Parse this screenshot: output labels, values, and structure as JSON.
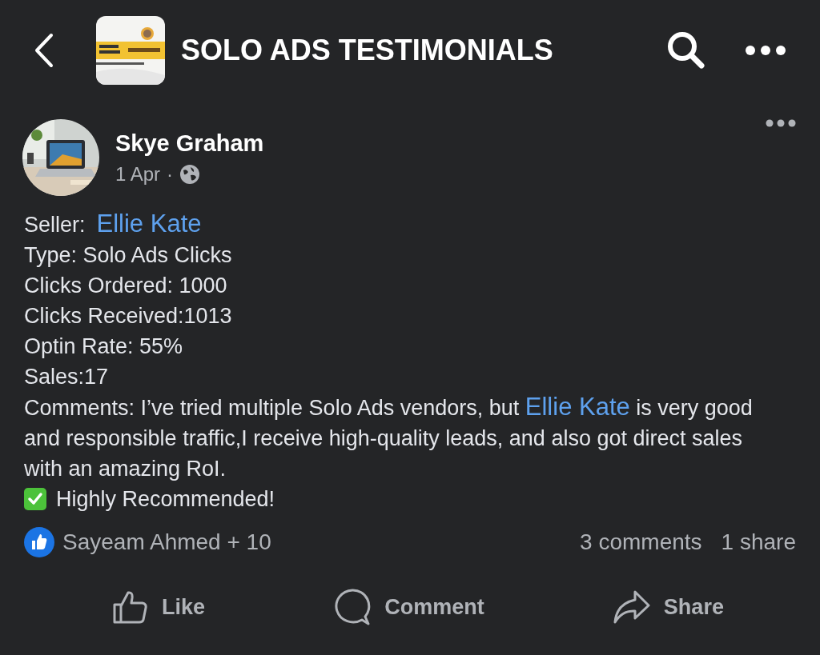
{
  "header": {
    "title": "SOLO ADS TESTIMONIALS"
  },
  "post": {
    "author": "Skye Graham",
    "time": "1 Apr",
    "separator": "·",
    "lines": [
      {
        "kind": "link",
        "text": "Seller:",
        "link": "Ellie Kate"
      },
      {
        "kind": "plain",
        "text": "Type: Solo Ads Clicks"
      },
      {
        "kind": "plain",
        "text": "Clicks Ordered: 1000"
      },
      {
        "kind": "plain",
        "text": "Clicks Received:1013"
      },
      {
        "kind": "plain",
        "text": "Optin Rate: 55%"
      },
      {
        "kind": "plain",
        "text": "Sales:17"
      }
    ],
    "comments": {
      "before": "Comments: I’ve tried multiple Solo Ads vendors, but",
      "link": "Ellie Kate",
      "after": "is very good and responsible traffic,I receive high-quality leads, and also got direct sales with an amazing RoI."
    },
    "recommendation": "Highly Recommended!",
    "reactions": "Sayeam Ahmed + 10",
    "comment_count": "3 comments",
    "share_count": "1 share",
    "actions": [
      {
        "kind": "like",
        "label": "Like"
      },
      {
        "kind": "comment",
        "label": "Comment"
      },
      {
        "kind": "share",
        "label": "Share"
      }
    ]
  }
}
